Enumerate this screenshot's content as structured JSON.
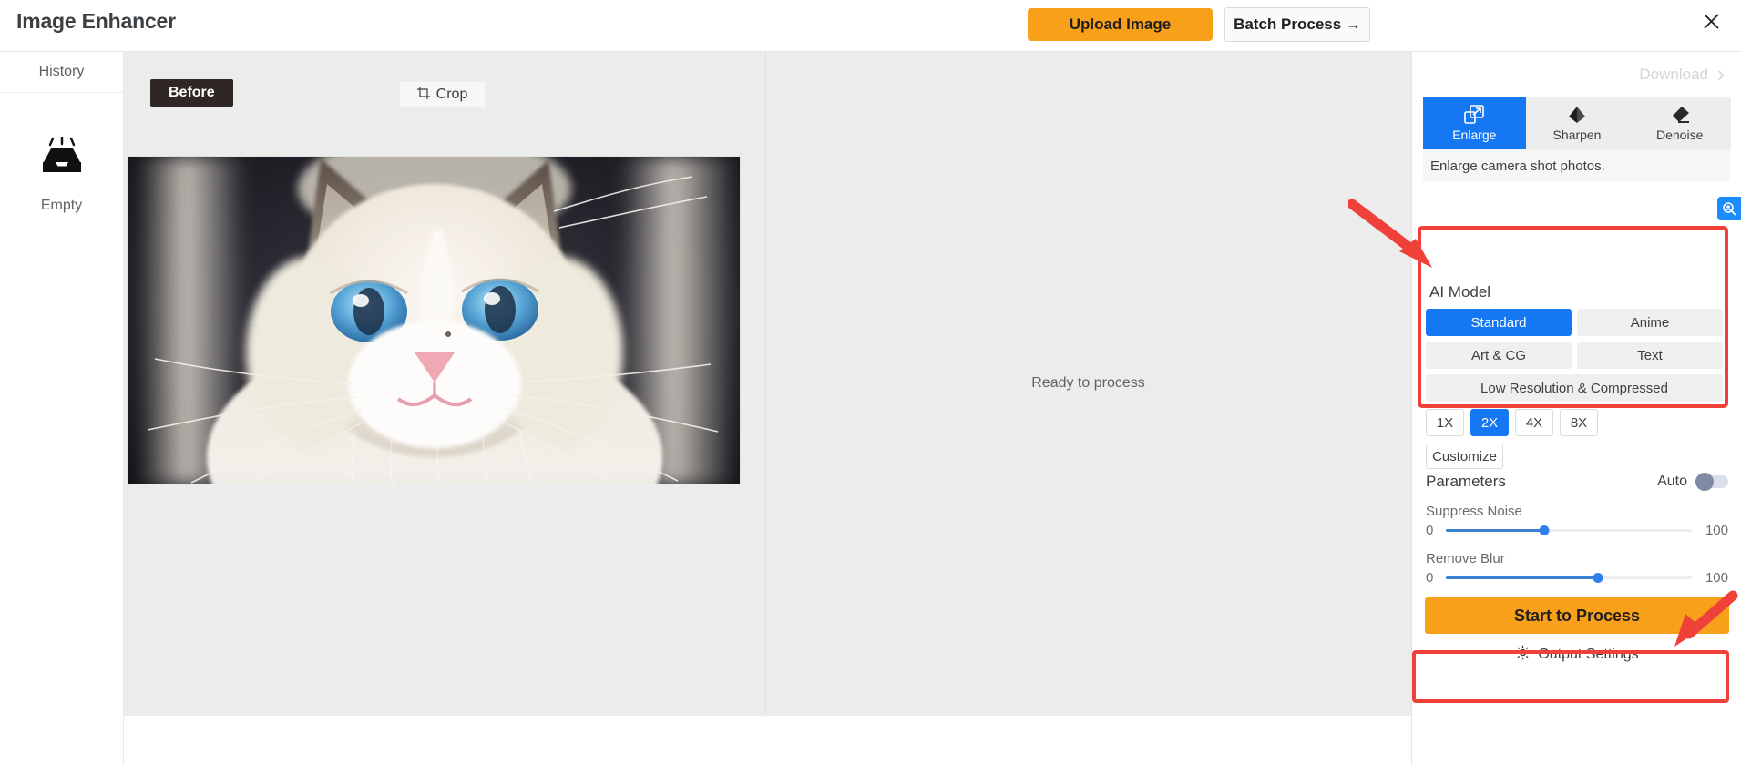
{
  "header": {
    "title": "Image Enhancer",
    "upload_label": "Upload Image",
    "batch_label": "Batch Process →",
    "close_icon": "close-icon"
  },
  "sidebar": {
    "history_label": "History",
    "empty_label": "Empty",
    "empty_icon": "inbox-empty-icon"
  },
  "canvas": {
    "before_badge": "Before",
    "crop_label": "Crop",
    "crop_icon": "crop-icon",
    "ready_text": "Ready to process"
  },
  "right_panel": {
    "download_label": "Download",
    "download_chevron": "›",
    "zoom_icon": "magnifier-icon",
    "tabs": [
      {
        "label": "Enlarge",
        "icon": "expand-icon",
        "active": true
      },
      {
        "label": "Sharpen",
        "icon": "sharpen-diamond-icon",
        "active": false
      },
      {
        "label": "Denoise",
        "icon": "eraser-icon",
        "active": false
      }
    ],
    "mode_description": "Enlarge camera shot photos.",
    "ai_model": {
      "title": "AI Model",
      "models": [
        {
          "label": "Standard",
          "active": true,
          "width": "half"
        },
        {
          "label": "Anime",
          "active": false,
          "width": "half"
        },
        {
          "label": "Art & CG",
          "active": false,
          "width": "half"
        },
        {
          "label": "Text",
          "active": false,
          "width": "half"
        },
        {
          "label": "Low Resolution & Compressed",
          "active": false,
          "width": "full"
        }
      ],
      "scales": [
        {
          "label": "1X",
          "active": false
        },
        {
          "label": "2X",
          "active": true
        },
        {
          "label": "4X",
          "active": false
        },
        {
          "label": "8X",
          "active": false
        }
      ],
      "customize_label": "Customize"
    },
    "parameters": {
      "title": "Parameters",
      "auto_label": "Auto",
      "auto_on": false,
      "sliders": [
        {
          "label": "Suppress Noise",
          "min": "0",
          "max": "100",
          "value": 40
        },
        {
          "label": "Remove Blur",
          "min": "0",
          "max": "100",
          "value": 62
        }
      ]
    },
    "start_label": "Start to Process",
    "output_settings_label": "Output Settings",
    "output_settings_icon": "gear-icon"
  },
  "colors": {
    "accent_orange": "#f9a01b",
    "accent_blue": "#1677f2",
    "annotation_red": "#f0403a",
    "slider_blue": "#2f80ed"
  }
}
